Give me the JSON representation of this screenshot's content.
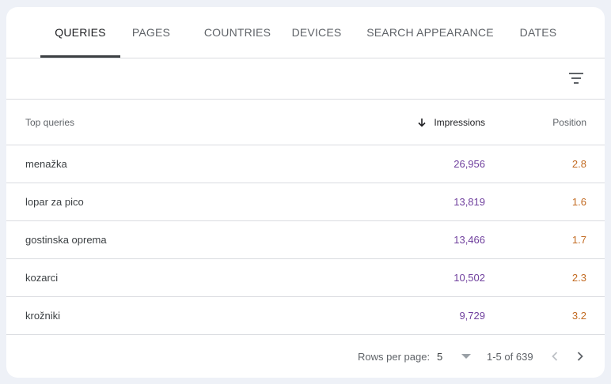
{
  "tabs": [
    {
      "label": "QUERIES",
      "active": true
    },
    {
      "label": "PAGES"
    },
    {
      "label": "COUNTRIES"
    },
    {
      "label": "DEVICES"
    },
    {
      "label": "SEARCH APPEARANCE"
    },
    {
      "label": "DATES"
    }
  ],
  "toolbar": {
    "filter_icon": "filter-list-icon"
  },
  "table": {
    "headers": {
      "query": "Top queries",
      "impressions": "Impressions",
      "position": "Position"
    },
    "sort": {
      "column": "impressions",
      "direction": "descending",
      "icon": "arrow-down-icon"
    },
    "rows": [
      {
        "query": "menažka",
        "impressions": "26,956",
        "position": "2.8"
      },
      {
        "query": "lopar za pico",
        "impressions": "13,819",
        "position": "1.6"
      },
      {
        "query": "gostinska oprema",
        "impressions": "13,466",
        "position": "1.7"
      },
      {
        "query": "kozarci",
        "impressions": "10,502",
        "position": "2.3"
      },
      {
        "query": "krožniki",
        "impressions": "9,729",
        "position": "3.2"
      }
    ]
  },
  "footer": {
    "rows_per_page_label": "Rows per page:",
    "rows_per_page_value": "5",
    "range": "1-5 of 639",
    "prev_icon": "chevron-left-icon",
    "next_icon": "chevron-right-icon"
  },
  "colors": {
    "impressions": "#6f3f9d",
    "position": "#c26a21",
    "active_tab_indicator": "#3c4043",
    "background": "#eef1f7"
  }
}
